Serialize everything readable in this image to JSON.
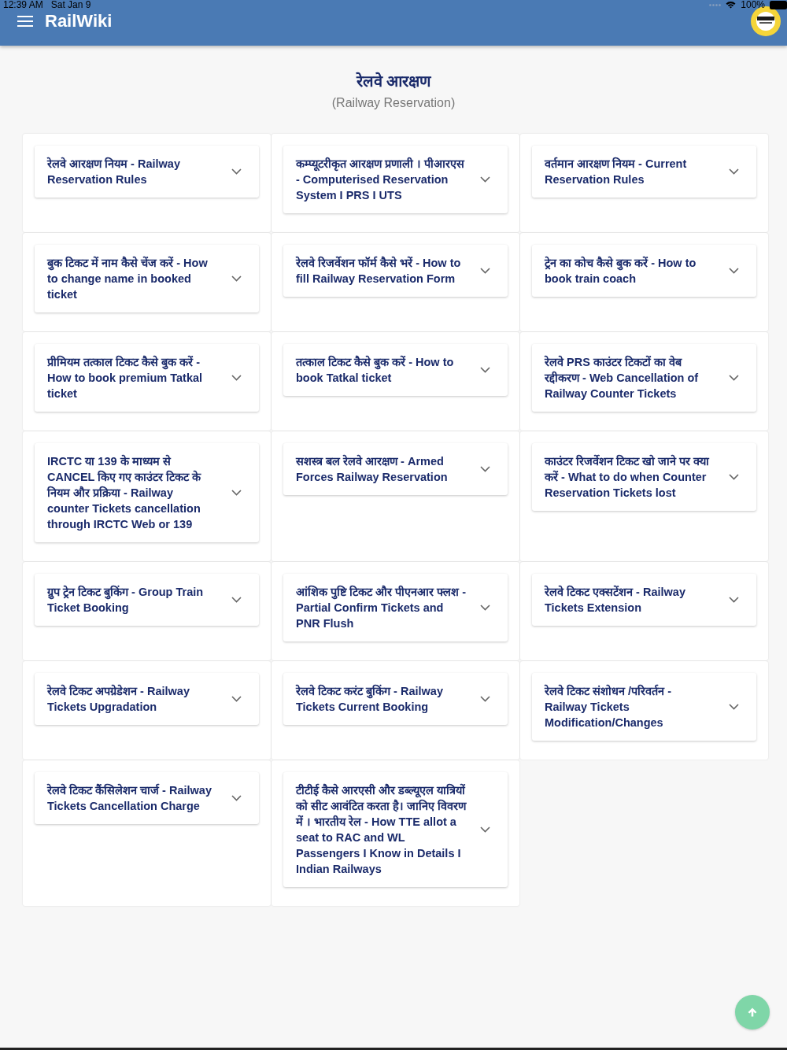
{
  "status_bar": {
    "time": "12:39 AM",
    "date": "Sat Jan 9",
    "battery": "100%"
  },
  "app_bar": {
    "title": "RailWiki"
  },
  "page": {
    "title": "रेलवे आरक्षण",
    "subtitle": "(Railway Reservation)"
  },
  "topics": [
    {
      "title": "रेलवे आरक्षण नियम - Railway Reservation Rules",
      "expanded": false
    },
    {
      "title": "कम्प्यूटरीकृत आरक्षण प्रणाली । पीआरएस - Computerised Reservation System I PRS I UTS",
      "expanded": false
    },
    {
      "title": "वर्तमान आरक्षण नियम - Current Reservation Rules",
      "expanded": false
    },
    {
      "title": "बुक टिकट में नाम कैसे चेंज करें - How to change name in booked ticket",
      "expanded": false
    },
    {
      "title": "रेलवे रिजर्वेशन फॉर्म कैसे भरें - How to fill Railway Reservation Form",
      "expanded": false
    },
    {
      "title": "ट्रेन का कोच कैसे बुक करें - How to book train coach",
      "expanded": false
    },
    {
      "title": "प्रीमियम तत्काल टिकट कैसे बुक करें - How to book premium Tatkal ticket",
      "expanded": false
    },
    {
      "title": "तत्काल टिकट कैसे बुक करें - How to book Tatkal ticket",
      "expanded": false
    },
    {
      "title": "रेलवे PRS काउंटर टिकटों का वेब रद्दीकरण - Web Cancellation of Railway Counter Tickets",
      "expanded": false
    },
    {
      "title": "IRCTC या 139 के माध्यम से CANCEL किए गए काउंटर टिकट के नियम और प्रक्रिया - Railway counter Tickets cancellation through IRCTC Web or 139",
      "expanded": false
    },
    {
      "title": "सशस्त्र बल रेलवे आरक्षण - Armed Forces Railway Reservation",
      "expanded": false
    },
    {
      "title": "काउंटर रिजर्वेशन टिकट खो जाने पर क्या करें - What to do when Counter Reservation Tickets lost",
      "expanded": false
    },
    {
      "title": "ग्रुप ट्रेन टिकट बुकिंग - Group Train Ticket Booking",
      "expanded": false
    },
    {
      "title": "आंशिक पुष्टि टिकट और पीएनआर फ्लश - Partial Confirm Tickets and PNR Flush",
      "expanded": false
    },
    {
      "title": "रेलवे टिकट एक्सटेंशन - Railway Tickets Extension",
      "expanded": false
    },
    {
      "title": "रेलवे टिकट अपग्रेडेशन - Railway Tickets Upgradation",
      "expanded": false
    },
    {
      "title": "रेलवे टिकट करंट बुकिंग - Railway Tickets Current Booking",
      "expanded": false
    },
    {
      "title": "रेलवे टिकट संशोधन /परिवर्तन - Railway Tickets Modification/Changes",
      "expanded": false
    },
    {
      "title": "रेलवे टिकट कैंसिलेशन चार्ज - Railway Tickets Cancellation Charge",
      "expanded": false
    },
    {
      "title": "टीटीई कैसे आरएसी और डब्ल्यूएल यात्रियों को सीट आवंटित करता है। जानिए विवरण में । भारतीय रेल - How TTE allot a seat to RAC and WL Passengers I Know in Details I Indian Railways",
      "expanded": false
    }
  ]
}
